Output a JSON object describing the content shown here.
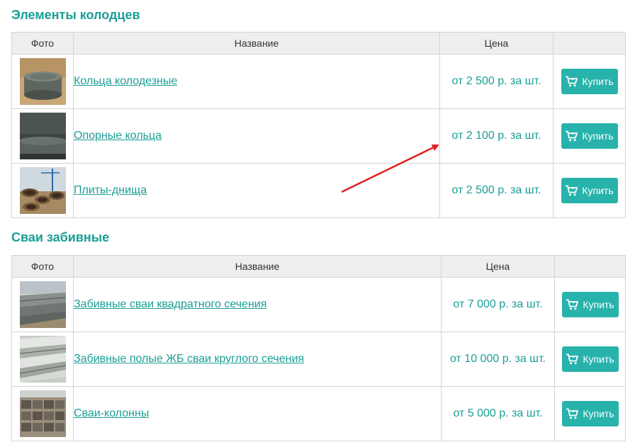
{
  "colors": {
    "accent": "#1a9e96",
    "button": "#27b3ac",
    "header_bg": "#eeeeee",
    "arrow": "#e02020"
  },
  "icons": {
    "cart": "shopping-cart-icon"
  },
  "sections": [
    {
      "title": "Элементы колодцев",
      "columns": {
        "photo": "Фото",
        "name": "Название",
        "price": "Цена",
        "action": ""
      },
      "rows": [
        {
          "name": "Кольца колодезные",
          "price": "от 2 500 р. за шт.",
          "buy": "Купить",
          "photo": "ring"
        },
        {
          "name": "Опорные кольца",
          "price": "от 2 100 р. за шт.",
          "buy": "Купить",
          "photo": "support-ring"
        },
        {
          "name": "Плиты-днища",
          "price": "от 2 500 р. за шт.",
          "buy": "Купить",
          "photo": "slabs"
        }
      ]
    },
    {
      "title": "Сваи забивные",
      "columns": {
        "photo": "Фото",
        "name": "Название",
        "price": "Цена",
        "action": ""
      },
      "rows": [
        {
          "name": "Забивные сваи квадратного сечения",
          "price": "от 7 000 р. за шт.",
          "buy": "Купить",
          "photo": "square-piles"
        },
        {
          "name": "Забивные полые ЖБ сваи круглого сечения",
          "price": "от 10 000 р. за шт.",
          "buy": "Купить",
          "photo": "hollow-piles"
        },
        {
          "name": "Сваи-колонны",
          "price": "от 5 000 р. за шт.",
          "buy": "Купить",
          "photo": "pile-columns"
        }
      ]
    }
  ]
}
